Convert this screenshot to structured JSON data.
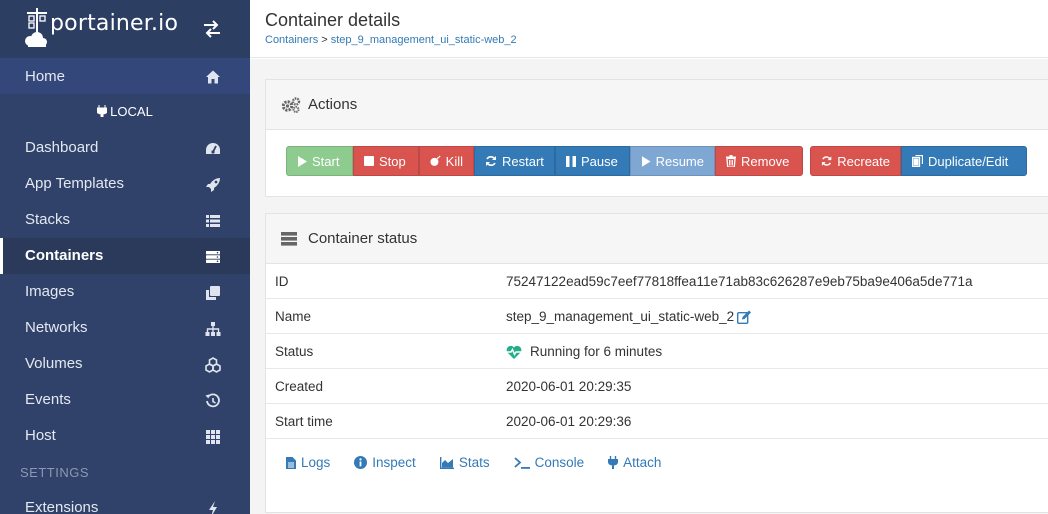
{
  "brand": {
    "name": "portainer.io"
  },
  "nav": {
    "home": "Home",
    "endpoint": "LOCAL",
    "items": [
      {
        "label": "Dashboard",
        "icon": "tachometer-icon"
      },
      {
        "label": "App Templates",
        "icon": "rocket-icon"
      },
      {
        "label": "Stacks",
        "icon": "th-list-icon"
      },
      {
        "label": "Containers",
        "icon": "server-icon",
        "active": true
      },
      {
        "label": "Images",
        "icon": "clone-icon"
      },
      {
        "label": "Networks",
        "icon": "sitemap-icon"
      },
      {
        "label": "Volumes",
        "icon": "cubes-icon"
      },
      {
        "label": "Events",
        "icon": "history-icon"
      },
      {
        "label": "Host",
        "icon": "th-icon"
      }
    ],
    "settings_title": "SETTINGS",
    "extensions": "Extensions"
  },
  "header": {
    "title": "Container details",
    "breadcrumb_link": "Containers",
    "breadcrumb_sep": " > ",
    "breadcrumb_current": "step_9_management_ui_static-web_2"
  },
  "actions": {
    "title": "Actions",
    "buttons": {
      "start": "Start",
      "stop": "Stop",
      "kill": "Kill",
      "restart": "Restart",
      "pause": "Pause",
      "resume": "Resume",
      "remove": "Remove",
      "recreate": "Recreate",
      "duplicate": "Duplicate/Edit"
    }
  },
  "status": {
    "title": "Container status",
    "rows": [
      {
        "key": "ID",
        "value": "75247122ead59c7eef77818ffea11e71ab83c626287e9eb75ba9e406a5de771a"
      },
      {
        "key": "Name",
        "value": "step_9_management_ui_static-web_2"
      },
      {
        "key": "Status",
        "value": "Running for 6 minutes"
      },
      {
        "key": "Created",
        "value": "2020-06-01 20:29:35"
      },
      {
        "key": "Start time",
        "value": "2020-06-01 20:29:36"
      }
    ],
    "links": {
      "logs": "Logs",
      "inspect": "Inspect",
      "stats": "Stats",
      "console": "Console",
      "attach": "Attach"
    }
  },
  "colors": {
    "sidebar": "#30426a",
    "primary": "#337ab7",
    "danger": "#d9534f",
    "success": "#8ecb8e",
    "running": "#23ae89"
  }
}
